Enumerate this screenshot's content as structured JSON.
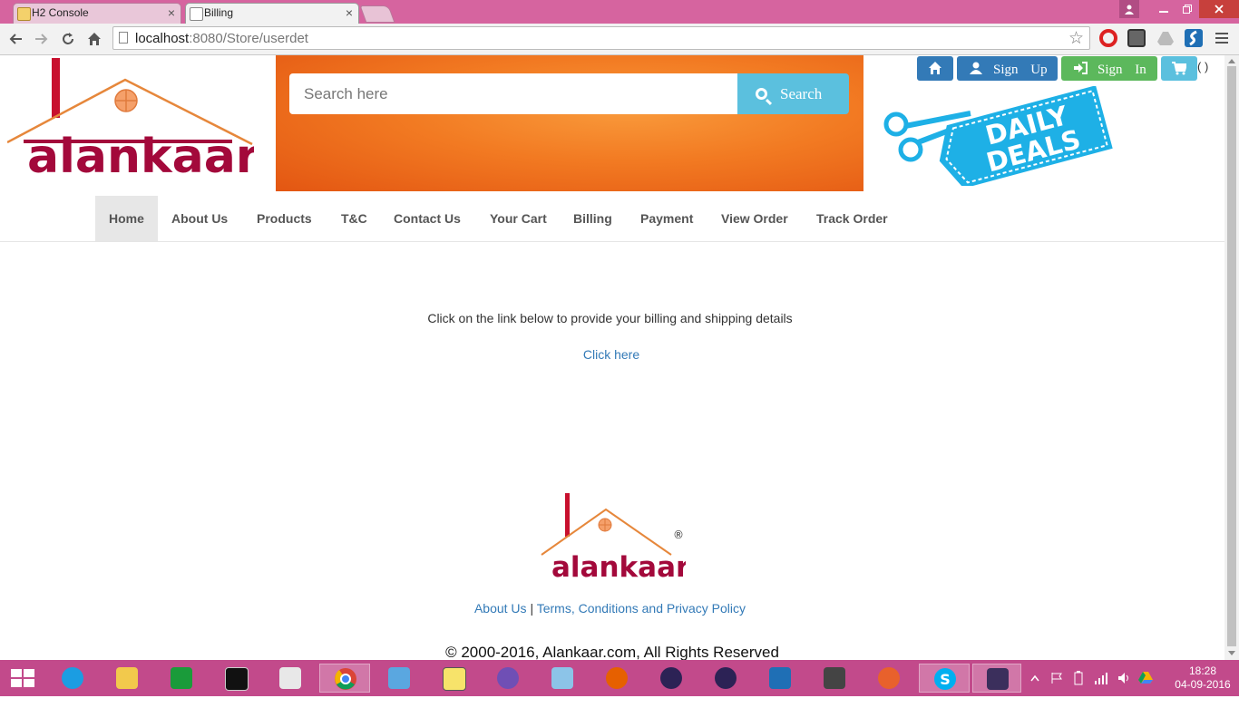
{
  "browser": {
    "tabs": [
      {
        "label": "H2 Console",
        "close": "×"
      },
      {
        "label": "Billing",
        "close": "×"
      }
    ],
    "address": {
      "host": "localhost",
      "rest": ":8080/Store/userdet"
    }
  },
  "header": {
    "logo_text": "alankaar",
    "search": {
      "placeholder": "Search here",
      "button_label": "Search"
    },
    "buttons": {
      "signup": "Sign Up",
      "signin": "Sign In",
      "cart_count": "( )"
    },
    "deals_text": [
      "DAILY",
      "DEALS"
    ]
  },
  "nav": {
    "items": [
      "Home",
      "About Us",
      "Products",
      "T&C",
      "Contact Us",
      "Your Cart",
      "Billing",
      "Payment",
      "View Order",
      "Track Order"
    ],
    "active": "Home"
  },
  "content": {
    "message": "Click on the link below to provide your billing and shipping details",
    "link": "Click here"
  },
  "footer": {
    "logo_text": "alankaar",
    "registered": "®",
    "link_about": "About Us",
    "separator": "|",
    "link_terms": "Terms, Conditions and Privacy Policy",
    "copyright": "© 2000-2016, Alankaar.com, All Rights Reserved"
  },
  "taskbar": {
    "time": "18:28",
    "date": "04-09-2016"
  },
  "colors": {
    "primary": "#337ab7",
    "success": "#5cb85c",
    "info": "#5bc0de",
    "brand": "#a3093b",
    "taskbar": "#c24a8b"
  }
}
